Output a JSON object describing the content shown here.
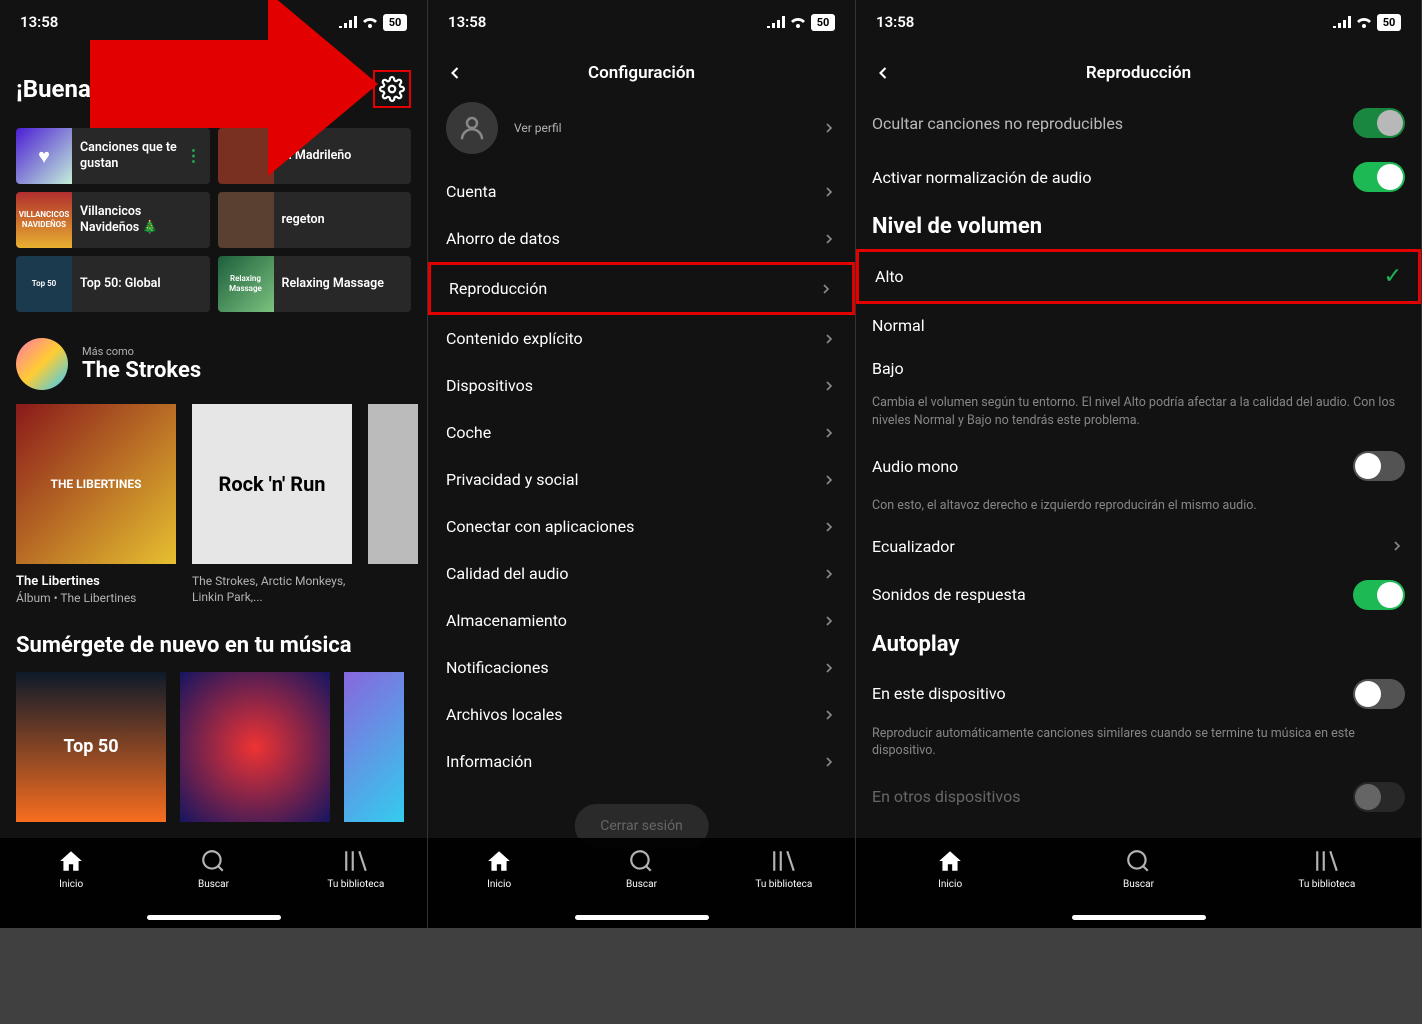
{
  "status": {
    "time": "13:58",
    "battery": "50"
  },
  "screen1": {
    "greeting": "¡Buenas",
    "tiles": [
      {
        "label": "Canciones que te gustan"
      },
      {
        "label": "El Madrileño"
      },
      {
        "label": "Villancicos Navideños 🎄"
      },
      {
        "label": "regeton"
      },
      {
        "label": "Top 50: Global"
      },
      {
        "label": "Relaxing Massage"
      }
    ],
    "more_like": "Más como",
    "artist": "The Strokes",
    "albums": [
      {
        "title": "The Libertines",
        "sub": "Álbum • The Libertines",
        "art_text": "THE LIBERTINES"
      },
      {
        "title": "The Strokes, Arctic Monkeys, Linkin Park,...",
        "sub": "",
        "art_text": "Rock 'n' Run"
      }
    ],
    "dive_title": "Sumérgete de nuevo en tu música",
    "mini": [
      "Top 50"
    ]
  },
  "screen2": {
    "title": "Configuración",
    "view_profile": "Ver perfil",
    "items": [
      "Cuenta",
      "Ahorro de datos",
      "Reproducción",
      "Contenido explícito",
      "Dispositivos",
      "Coche",
      "Privacidad y social",
      "Conectar con aplicaciones",
      "Calidad del audio",
      "Almacenamiento",
      "Notificaciones",
      "Archivos locales",
      "Información"
    ],
    "pill": "Cerrar sesión"
  },
  "screen3": {
    "title": "Reproducción",
    "hide_songs": "Ocultar canciones no reproducibles",
    "normalize": "Activar normalización de audio",
    "volume_section": "Nivel de volumen",
    "volume_options": [
      "Alto",
      "Normal",
      "Bajo"
    ],
    "volume_help": "Cambia el volumen según tu entorno. El nivel Alto podría afectar a la calidad del audio. Con los niveles Normal y Bajo no tendrás este problema.",
    "mono_audio": "Audio mono",
    "mono_help": "Con esto, el altavoz derecho e izquierdo reproducirán el mismo audio.",
    "equalizer": "Ecualizador",
    "response_sounds": "Sonidos de respuesta",
    "autoplay_section": "Autoplay",
    "autoplay_this": "En este dispositivo",
    "autoplay_help": "Reproducir automáticamente canciones similares cuando se termine tu música en este dispositivo.",
    "autoplay_other": "En otros dispositivos"
  },
  "nav": {
    "home": "Inicio",
    "search": "Buscar",
    "library": "Tu biblioteca"
  }
}
